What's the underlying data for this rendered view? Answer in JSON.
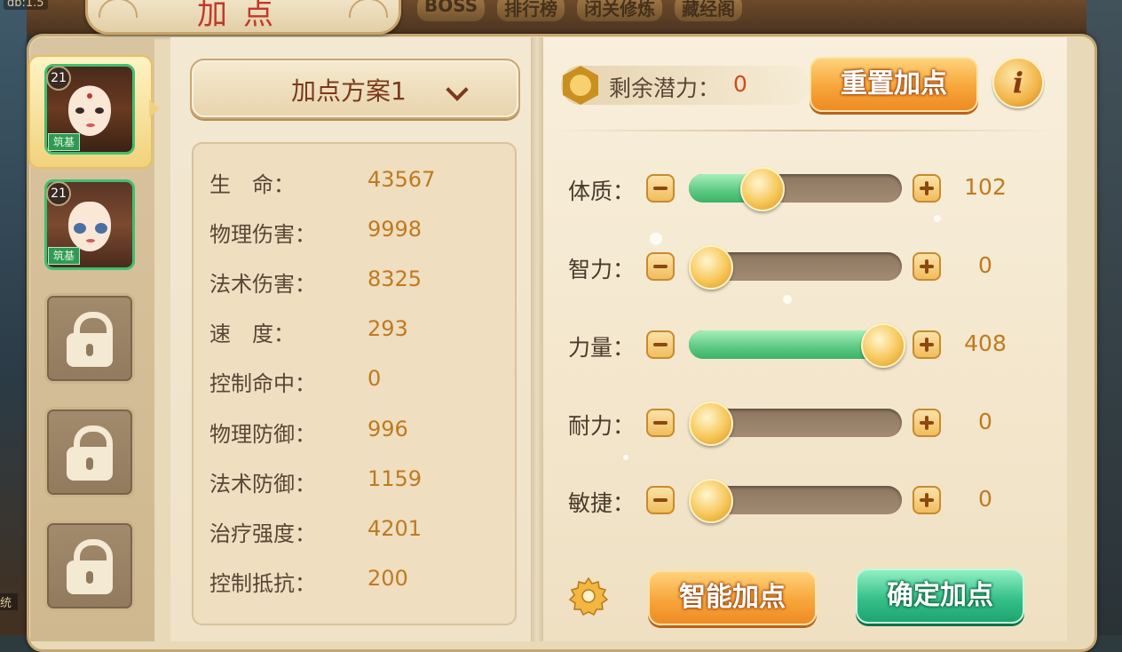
{
  "topbar": {
    "left_tag": "db:1.5",
    "nav": [
      "BOSS",
      "排行榜",
      "闭关修炼",
      "藏经阁"
    ],
    "bottom_left_tag": "统"
  },
  "title": "加点",
  "characters": [
    {
      "level": "21",
      "realm": "筑基",
      "selected": true
    },
    {
      "level": "21",
      "realm": "筑基",
      "selected": false
    }
  ],
  "locked_slots": 3,
  "scheme": {
    "label": "加点方案1"
  },
  "stats": [
    {
      "label": "生　命：",
      "value": "43567"
    },
    {
      "label": "物理伤害：",
      "value": "9998"
    },
    {
      "label": "法术伤害：",
      "value": "8325"
    },
    {
      "label": "速　度：",
      "value": "293"
    },
    {
      "label": "控制命中：",
      "value": "0"
    },
    {
      "label": "物理防御：",
      "value": "996"
    },
    {
      "label": "法术防御：",
      "value": "1159"
    },
    {
      "label": "治疗强度：",
      "value": "4201"
    },
    {
      "label": "控制抵抗：",
      "value": "200"
    }
  ],
  "potential": {
    "label": "剩余潜力：",
    "value": "0"
  },
  "buttons": {
    "reset": "重置加点",
    "info": "i",
    "smart": "智能加点",
    "confirm": "确定加点"
  },
  "attributes": [
    {
      "label": "体质：",
      "value": "102",
      "level": 0.3
    },
    {
      "label": "智力：",
      "value": "0",
      "level": 0.0
    },
    {
      "label": "力量：",
      "value": "408",
      "level": 1.0
    },
    {
      "label": "耐力：",
      "value": "0",
      "level": 0.0
    },
    {
      "label": "敏捷：",
      "value": "0",
      "level": 0.0
    }
  ],
  "colors": {
    "accent_orange": "#f7a63a",
    "accent_green": "#37c08a",
    "value_text": "#c07a1f",
    "potential_value": "#d24a1a",
    "title_red": "#c0392b"
  }
}
